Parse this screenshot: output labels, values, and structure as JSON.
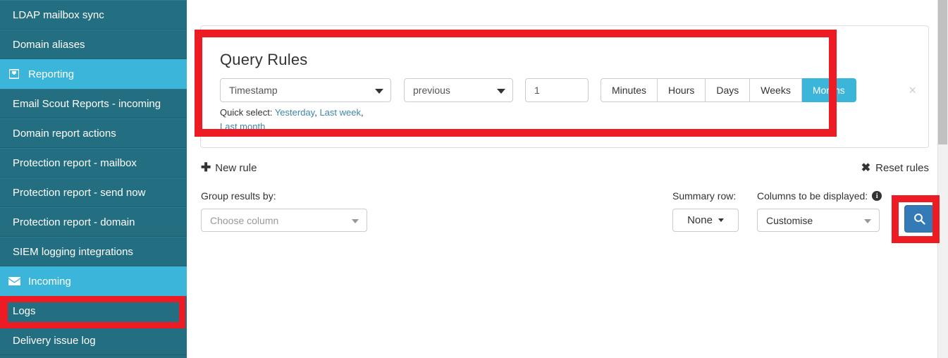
{
  "sidebar": {
    "items": [
      {
        "label": "LDAP mailbox sync",
        "type": "item",
        "icon": ""
      },
      {
        "label": "Domain aliases",
        "type": "item",
        "icon": ""
      },
      {
        "label": "Reporting",
        "type": "header",
        "icon": "inbox-icon"
      },
      {
        "label": "Email Scout Reports - incoming",
        "type": "item",
        "icon": ""
      },
      {
        "label": "Domain report actions",
        "type": "item",
        "icon": ""
      },
      {
        "label": "Protection report - mailbox",
        "type": "item",
        "icon": ""
      },
      {
        "label": "Protection report - send now",
        "type": "item",
        "icon": ""
      },
      {
        "label": "Protection report - domain",
        "type": "item",
        "icon": ""
      },
      {
        "label": "SIEM logging integrations",
        "type": "item",
        "icon": ""
      },
      {
        "label": "Incoming",
        "type": "header",
        "icon": "envelope-icon"
      },
      {
        "label": "Logs",
        "type": "item",
        "icon": "",
        "highlighted": true
      },
      {
        "label": "Delivery issue log",
        "type": "item",
        "icon": ""
      }
    ],
    "colors": {
      "item_background": "#236e80",
      "header_background": "#3bb5d9",
      "text": "#ffffff"
    }
  },
  "query_panel": {
    "title": "Query Rules",
    "rule": {
      "field_value": "Timestamp",
      "operator_value": "previous",
      "amount_value": "1",
      "units": [
        {
          "label": "Minutes",
          "active": false
        },
        {
          "label": "Hours",
          "active": false
        },
        {
          "label": "Days",
          "active": false
        },
        {
          "label": "Weeks",
          "active": false
        },
        {
          "label": "Months",
          "active": true
        }
      ],
      "remove_icon": "×"
    },
    "quick_select": {
      "prefix": "Quick select:",
      "links": [
        "Yesterday",
        "Last week",
        "Last month"
      ]
    }
  },
  "actions": {
    "new_rule_label": "New rule",
    "new_rule_icon": "plus-icon",
    "reset_rules_label": "Reset rules",
    "reset_rules_icon": "close-x-icon"
  },
  "controls": {
    "group_label": "Group results by:",
    "group_placeholder": "Choose column",
    "summary_label": "Summary row:",
    "summary_value": "None",
    "columns_label": "Columns to be displayed:",
    "columns_info_icon": "info-icon",
    "columns_value": "Customise",
    "search_icon": "search-icon"
  },
  "colors": {
    "accent_teal": "#3bb5d9",
    "sidebar_dark": "#236e80",
    "primary_blue": "#337ab7",
    "highlight_red": "#ed1c24",
    "link_blue": "#3a87ad"
  }
}
